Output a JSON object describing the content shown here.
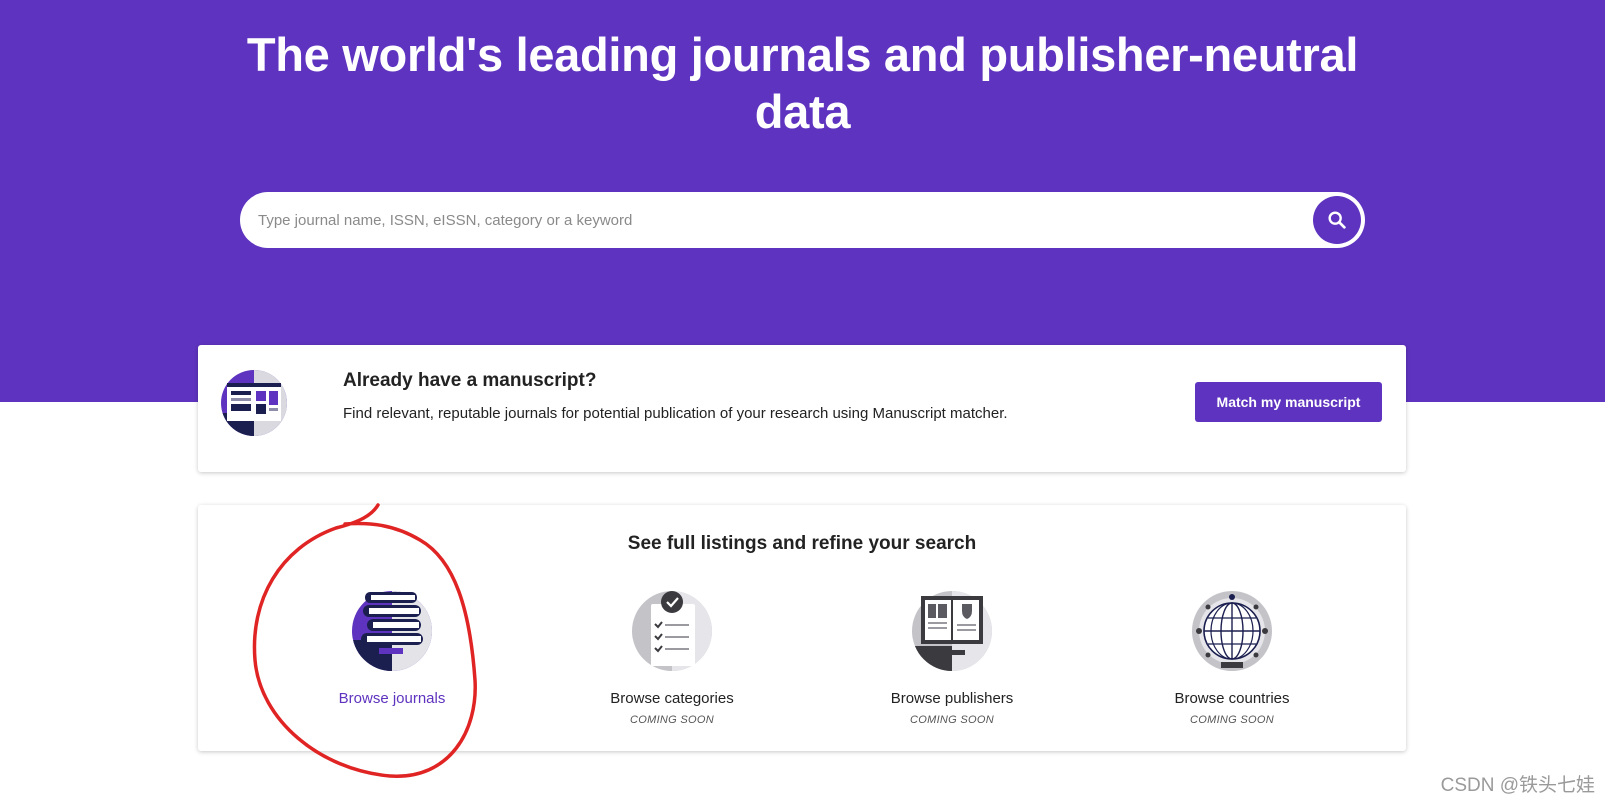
{
  "hero": {
    "title": "The world's leading journals and publisher-neutral data",
    "background_color": "#5e33bf"
  },
  "search": {
    "placeholder": "Type journal name, ISSN, eISSN, category or a keyword",
    "value": "",
    "button_icon": "search-icon"
  },
  "manuscript": {
    "heading": "Already have a manuscript?",
    "description": "Find relevant, reputable journals for potential publication of your research using Manuscript matcher.",
    "button_label": "Match my manuscript",
    "illustration_icon": "manuscript-illustration-icon"
  },
  "browse": {
    "heading": "See full listings and refine your search",
    "items": [
      {
        "label": "Browse journals",
        "status": "",
        "icon": "stacked-books-icon"
      },
      {
        "label": "Browse categories",
        "status": "COMING SOON",
        "icon": "checklist-icon"
      },
      {
        "label": "Browse publishers",
        "status": "COMING SOON",
        "icon": "open-book-icon"
      },
      {
        "label": "Browse countries",
        "status": "COMING SOON",
        "icon": "globe-icon"
      }
    ]
  },
  "annotation": {
    "color": "#e02424",
    "target": "Browse journals"
  },
  "watermark": "CSDN @铁头七娃",
  "colors": {
    "accent": "#5e33bf",
    "annotation": "#e02424"
  }
}
